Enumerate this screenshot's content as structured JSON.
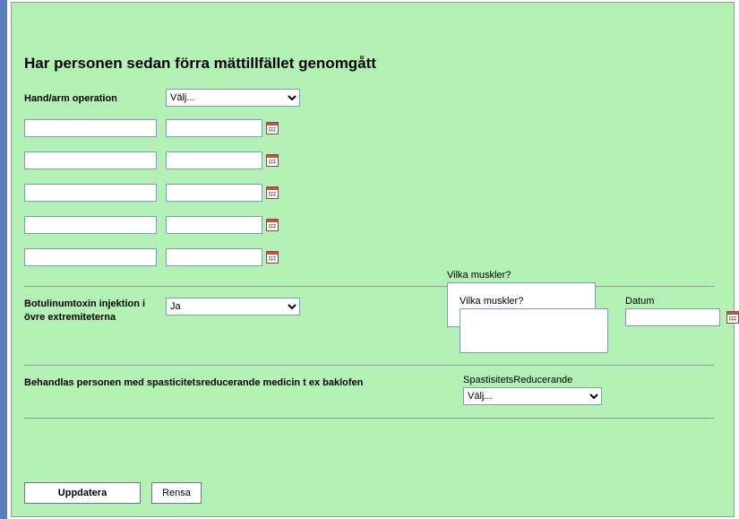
{
  "title": "Har personen sedan förra mättillfället genomgått",
  "hand_arm": {
    "label": "Hand/arm operation",
    "select_value": "Välj...",
    "options": [
      "Välj..."
    ]
  },
  "date_pairs": [
    {
      "a": "",
      "b": ""
    },
    {
      "a": "",
      "b": ""
    },
    {
      "a": "",
      "b": ""
    },
    {
      "a": "",
      "b": ""
    },
    {
      "a": "",
      "b": ""
    }
  ],
  "muscles1": {
    "label": "Vilka muskler?",
    "value": ""
  },
  "botulinum": {
    "label": "Botulinumtoxin injektion i övre extremiteterna",
    "select_value": "Ja",
    "options": [
      "Ja"
    ],
    "muscles_label": "Vilka muskler?",
    "muscles_value": "",
    "date_label": "Datum",
    "date_value": ""
  },
  "spasticity": {
    "label": "Behandlas personen med spasticitetsreducerande medicin t ex baklofen",
    "sub_label": "SpastisitetsReducerande",
    "select_value": "Välj...",
    "options": [
      "Välj..."
    ]
  },
  "buttons": {
    "update": "Uppdatera",
    "clear": "Rensa"
  }
}
